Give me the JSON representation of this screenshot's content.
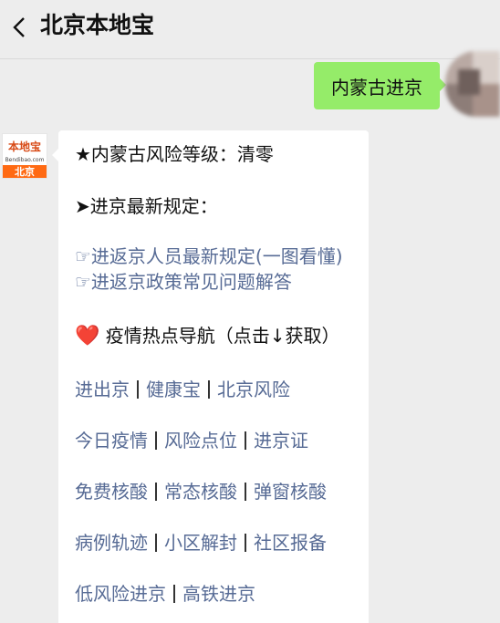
{
  "header": {
    "title": "北京本地宝",
    "back_icon": "chevron-left-icon"
  },
  "user_message": {
    "text": "内蒙古进京"
  },
  "bot_avatar": {
    "logo_text": "本地宝",
    "logo_domain": "Bendibao.com",
    "city": "北京"
  },
  "bot_message": {
    "risk_line": "★内蒙古风险等级：清零",
    "rules_heading": "➤进京最新规定：",
    "links": [
      "☞进返京人员最新规定(一图看懂)",
      "☞进返京政策常见问题解答"
    ],
    "hot_heart": "❤️",
    "hot_title": "疫情热点导航（点击↓获取）",
    "nav_rows": [
      [
        "进出京",
        "健康宝",
        "北京风险"
      ],
      [
        "今日疫情",
        "风险点位",
        "进京证"
      ],
      [
        "免费核酸",
        "常态核酸",
        "弹窗核酸"
      ],
      [
        "病例轨迹",
        "小区解封",
        "社区报备"
      ],
      [
        "低风险进京",
        "高铁进京"
      ]
    ]
  },
  "colors": {
    "background": "#ededed",
    "user_bubble": "#95ec69",
    "bot_bubble": "#ffffff",
    "link": "#576b95",
    "logo_orange": "#ff6a13"
  }
}
